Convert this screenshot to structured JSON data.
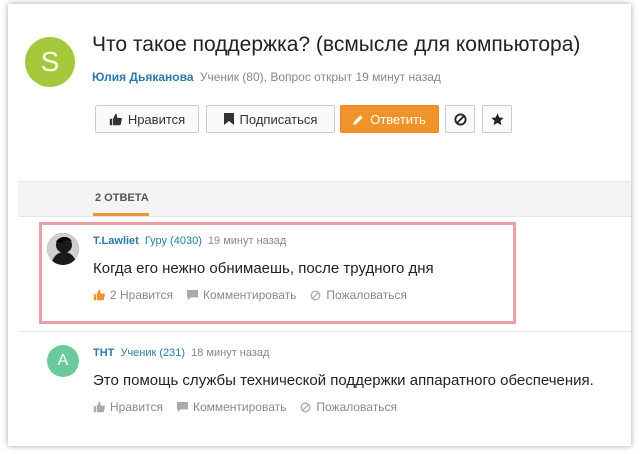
{
  "question": {
    "avatar_letter": "S",
    "title": "Что такое поддержка? (всмысле для компьютора)",
    "author": "Юлия Дьяканова",
    "meta": "Ученик (80), Вопрос открыт 19 минут назад"
  },
  "actions": {
    "like_label": "Нравится",
    "subscribe_label": "Подписаться",
    "answer_label": "Ответить"
  },
  "tabs": {
    "answers_label": "2 ОТВЕТА"
  },
  "answers": [
    {
      "author": "T.Lawliet",
      "rank": "Гуру (4030)",
      "time": "19 минут назад",
      "text": "Когда его нежно обнимаешь, после трудного дня",
      "like_label": "2 Нравится",
      "comment_label": "Комментировать",
      "report_label": "Пожаловаться"
    },
    {
      "avatar_letter": "A",
      "author": "THT",
      "rank": "Ученик (231)",
      "time": "18 минут назад",
      "text": "Это помощь службы технической поддержки аппаратного обеспечения.",
      "like_label": "Нравится",
      "comment_label": "Комментировать",
      "report_label": "Пожаловаться"
    }
  ],
  "colors": {
    "accent": "#f0932b",
    "link": "#2a7ba8",
    "avatar_question": "#a3c93a",
    "avatar_answer2": "#6bc99b",
    "highlight_border": "#e8a0a8"
  }
}
